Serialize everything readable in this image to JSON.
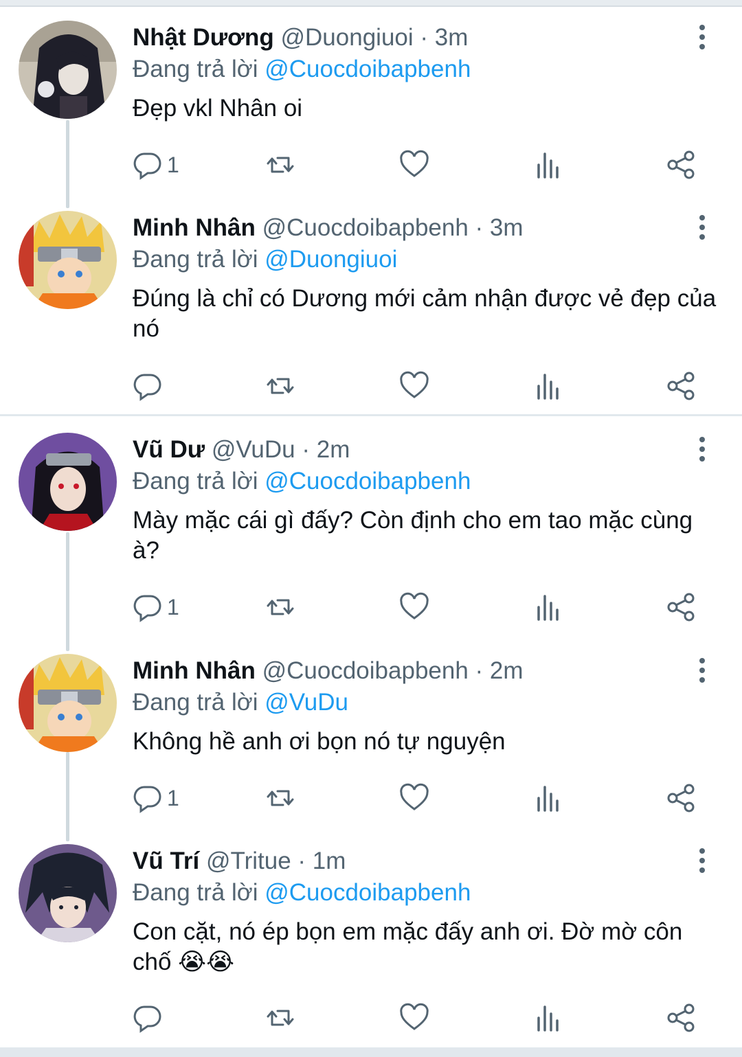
{
  "tweets": [
    {
      "name": "Nhật Dương",
      "handle": "@Duongiuoi",
      "time": "· 3m",
      "reply_prefix": "Đang trả lời",
      "reply_to": "@Cuocdoibapbenh",
      "text": "Đẹp vkl Nhân oi",
      "reply_count": "1",
      "avatar": "anime-girl-avatar"
    },
    {
      "name": "Minh Nhân",
      "handle": "@Cuocdoibapbenh",
      "time": "· 3m",
      "reply_prefix": "Đang trả lời",
      "reply_to": "@Duongiuoi",
      "text": "Đúng là chỉ có Dương mới cảm nhận được vẻ đẹp của nó",
      "reply_count": "",
      "avatar": "naruto-avatar"
    },
    {
      "name": "Vũ Dư",
      "handle": "@VuDu",
      "time": "· 2m",
      "reply_prefix": "Đang trả lời",
      "reply_to": "@Cuocdoibapbenh",
      "text": "Mày mặc cái gì đấy? Còn định cho em tao mặc cùng à?",
      "reply_count": "1",
      "avatar": "itachi-avatar"
    },
    {
      "name": "Minh Nhân",
      "handle": "@Cuocdoibapbenh",
      "time": "· 2m",
      "reply_prefix": "Đang trả lời",
      "reply_to": "@VuDu",
      "text": "Không hề anh ơi bọn nó tự nguyện",
      "reply_count": "1",
      "avatar": "naruto-avatar"
    },
    {
      "name": "Vũ Trí",
      "handle": "@Tritue",
      "time": "· 1m",
      "reply_prefix": "Đang trả lời",
      "reply_to": "@Cuocdoibapbenh",
      "text": "Con cặt, nó ép bọn em mặc đấy anh ơi. Đờ mờ côn chố",
      "emoji": "😭😭",
      "reply_count": "",
      "avatar": "sasuke-avatar"
    }
  ],
  "icons": {
    "reply": "reply-icon",
    "retweet": "retweet-icon",
    "like": "like-icon",
    "views": "views-icon",
    "share": "share-icon",
    "more": "more-icon"
  },
  "colors": {
    "text": "#0f1419",
    "secondary": "#536471",
    "mention": "#1d9bf0",
    "divider": "#e1e8ed"
  }
}
